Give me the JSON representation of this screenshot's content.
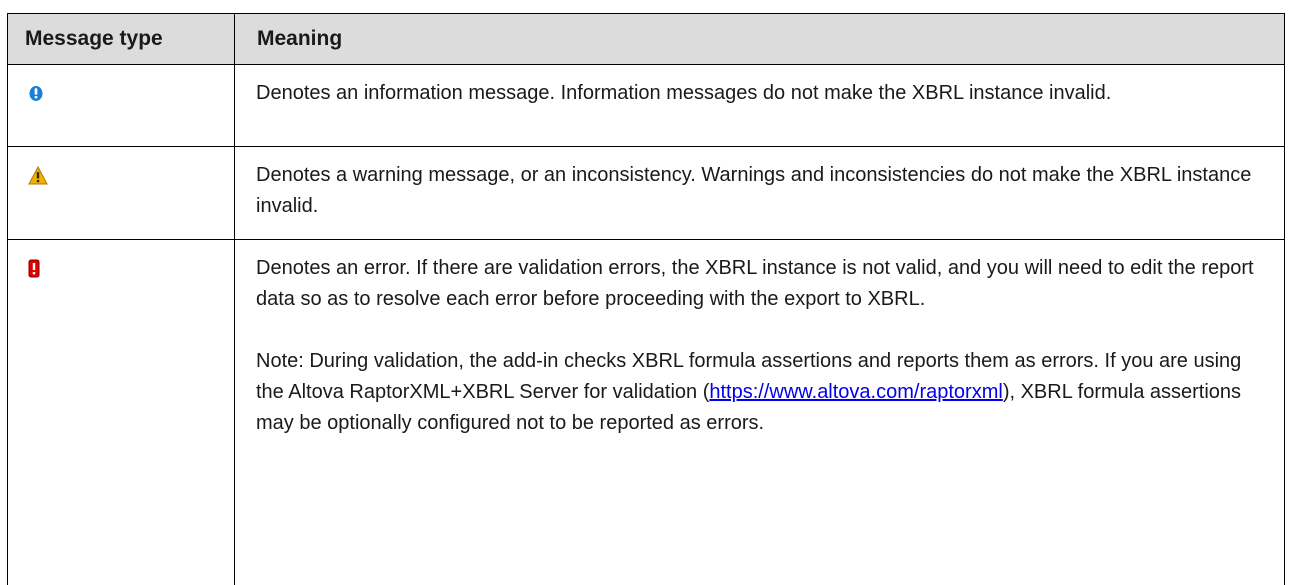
{
  "header": {
    "col_type": "Message type",
    "col_meaning": "Meaning"
  },
  "rows": [
    {
      "icon": "info-icon",
      "icon_color": "#1a7fd6",
      "meaning": "Denotes an information message. Information messages do not make the XBRL instance invalid."
    },
    {
      "icon": "warning-icon",
      "icon_color": "#f0b400",
      "meaning": "Denotes a warning message, or an inconsistency. Warnings and inconsistencies do not make the XBRL instance invalid."
    },
    {
      "icon": "error-icon",
      "icon_color": "#e00000",
      "meaning": "Denotes an error. If there are validation errors, the XBRL instance is not valid, and you will need to edit the report data so as to resolve each error before proceeding with the export to XBRL.",
      "note_before_link": "Note: During validation, the add-in checks XBRL formula assertions and reports them as errors. If you are using the Altova RaptorXML+XBRL Server for validation (",
      "note_link": "https://www.altova.com/raptorxml",
      "note_after_link": "), XBRL formula assertions may be optionally configured not to be reported as errors."
    }
  ]
}
